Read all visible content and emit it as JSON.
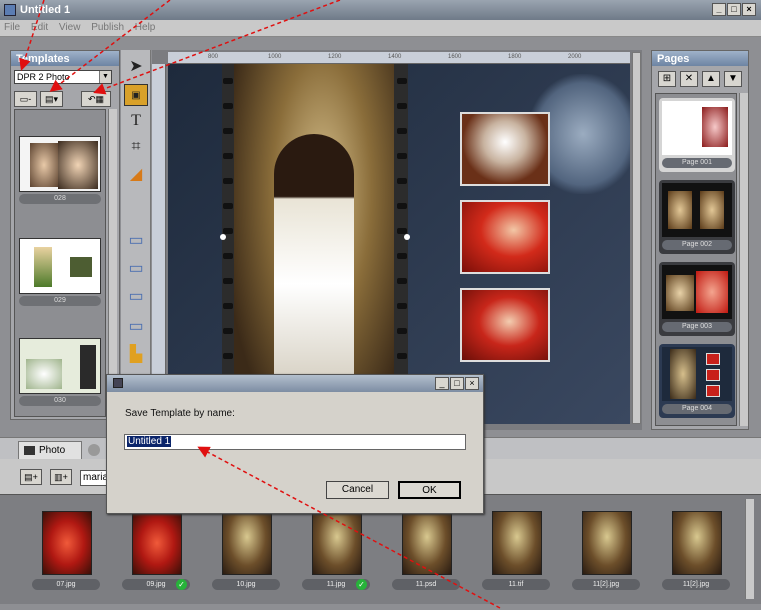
{
  "window": {
    "title": "Untitled 1"
  },
  "menu": [
    "File",
    "Edit",
    "View",
    "Publish",
    "Help"
  ],
  "templates": {
    "title": "Templates",
    "selected": "DPR 2 Photo",
    "items": [
      {
        "label": "028"
      },
      {
        "label": "029"
      },
      {
        "label": "030"
      }
    ]
  },
  "pages": {
    "title": "Pages",
    "items": [
      {
        "label": "Page 001"
      },
      {
        "label": "Page 002"
      },
      {
        "label": "Page 003"
      },
      {
        "label": "Page 004"
      }
    ]
  },
  "ruler": [
    "800",
    "1000",
    "1200",
    "1400",
    "1600",
    "1800",
    "2000"
  ],
  "tabs": {
    "photo": "Photo"
  },
  "bottom": {
    "search_value": "maria"
  },
  "photos": [
    {
      "name": "07.jpg",
      "checked": false
    },
    {
      "name": "09.jpg",
      "checked": true
    },
    {
      "name": "10.jpg",
      "checked": false
    },
    {
      "name": "11.jpg",
      "checked": true
    },
    {
      "name": "11.psd",
      "checked": false
    },
    {
      "name": "11.tif",
      "checked": false
    },
    {
      "name": "11[2].jpg",
      "checked": false
    },
    {
      "name": "11[2].jpg",
      "checked": false
    }
  ],
  "dialog": {
    "prompt": "Save Template by name:",
    "value": "Untitled 1",
    "cancel": "Cancel",
    "ok": "OK"
  },
  "annotation_color": "#e01010"
}
